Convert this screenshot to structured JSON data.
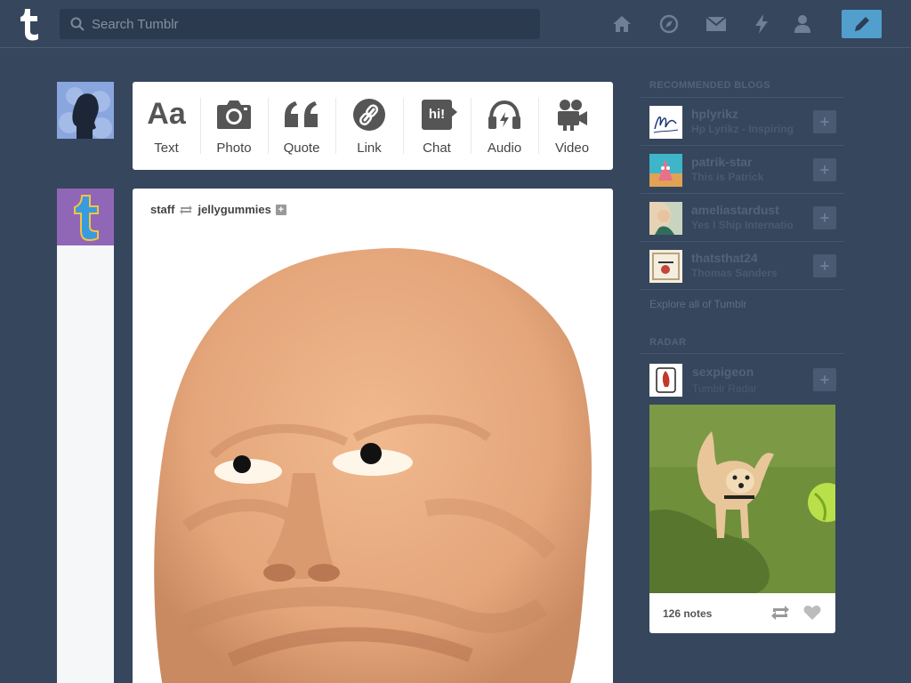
{
  "header": {
    "search_placeholder": "Search Tumblr",
    "nav_icons": [
      "home-icon",
      "compass-icon",
      "mail-icon",
      "lightning-icon",
      "account-icon"
    ],
    "compose_icon": "pencil-icon"
  },
  "post_types": [
    {
      "label": "Text",
      "glyph": "Aa",
      "icon": "text-icon"
    },
    {
      "label": "Photo",
      "icon": "camera-icon"
    },
    {
      "label": "Quote",
      "icon": "quote-icon"
    },
    {
      "label": "Link",
      "icon": "link-icon"
    },
    {
      "label": "Chat",
      "glyph": "hi!",
      "icon": "chat-icon"
    },
    {
      "label": "Audio",
      "icon": "headphones-icon"
    },
    {
      "label": "Video",
      "icon": "video-camera-icon"
    }
  ],
  "post": {
    "author": "staff",
    "reblogged_from": "jellygummies"
  },
  "sidebar": {
    "recommended_heading": "RECOMMENDED BLOGS",
    "blogs": [
      {
        "name": "hplyrikz",
        "subtitle": "Hp Lyrikz - Inspiring"
      },
      {
        "name": "patrik-star",
        "subtitle": "This is Patrick"
      },
      {
        "name": "ameliastardust",
        "subtitle": "Yes I Ship Internatio"
      },
      {
        "name": "thatsthat24",
        "subtitle": "Thomas Sanders"
      }
    ],
    "explore_link": "Explore all of Tumblr",
    "radar_heading": "RADAR",
    "radar": {
      "name": "sexpigeon",
      "subtitle": "Tumblr Radar",
      "notes": "126 notes"
    }
  },
  "colors": {
    "background": "#36465d",
    "accent": "#529ecc",
    "staff_avatar": "#9067b6"
  }
}
